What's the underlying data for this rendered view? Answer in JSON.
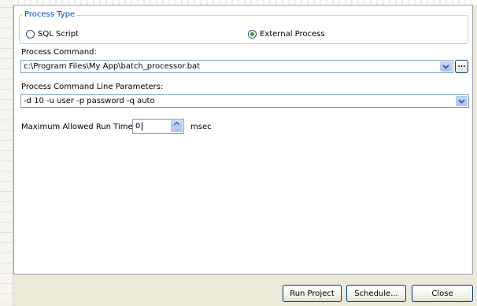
{
  "process_type": {
    "legend": "Process Type",
    "options": [
      {
        "label": "SQL Script",
        "selected": false
      },
      {
        "label": "External Process",
        "selected": true
      }
    ]
  },
  "process_command": {
    "label": "Process Command:",
    "value": "c:\\Program Files\\My App\\batch_processor.bat",
    "browse_label": "..."
  },
  "parameters": {
    "label": "Process Command Line Parameters:",
    "value": "-d 10 -u user -p password -q auto"
  },
  "run_time": {
    "label": "Maximum Allowed Run Time:",
    "value": "0",
    "unit": "msec"
  },
  "buttons": {
    "run_project": "Run Project",
    "schedule": "Schedule...",
    "close": "Close"
  },
  "icons": {
    "dropdown": "chevron-down-icon",
    "spin_up": "arrow-up-icon",
    "spin_down": "arrow-down-icon"
  },
  "colors": {
    "accent": "#0046d5",
    "radio_dot": "#21a121",
    "field_border": "#7f9db9"
  }
}
